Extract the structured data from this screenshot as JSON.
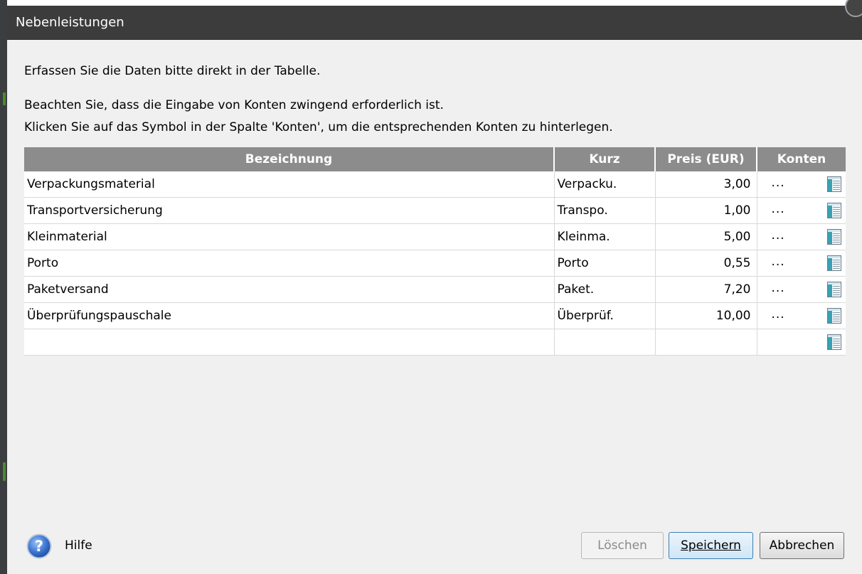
{
  "window": {
    "title": "Nebenleistungen"
  },
  "instructions": {
    "line1": "Erfassen Sie die Daten bitte direkt in der Tabelle.",
    "line2": "Beachten Sie, dass die Eingabe von Konten zwingend erforderlich ist.",
    "line3": "Klicken Sie auf das Symbol in der Spalte 'Konten', um die entsprechenden Konten zu  hinterlegen."
  },
  "table": {
    "columns": [
      "Bezeichnung",
      "Kurz",
      "Preis (EUR)",
      "Konten"
    ],
    "rows": [
      {
        "bezeichnung": "Verpackungsmaterial",
        "kurz": "Verpacku.",
        "preis": "3,00",
        "konten": "..."
      },
      {
        "bezeichnung": "Transportversicherung",
        "kurz": "Transpo.",
        "preis": "1,00",
        "konten": "..."
      },
      {
        "bezeichnung": "Kleinmaterial",
        "kurz": "Kleinma.",
        "preis": "5,00",
        "konten": "..."
      },
      {
        "bezeichnung": "Porto",
        "kurz": "Porto",
        "preis": "0,55",
        "konten": "..."
      },
      {
        "bezeichnung": "Paketversand",
        "kurz": "Paket.",
        "preis": "7,20",
        "konten": "..."
      },
      {
        "bezeichnung": "Überprüfungspauschale",
        "kurz": "Überprüf.",
        "preis": "10,00",
        "konten": "..."
      },
      {
        "bezeichnung": "",
        "kurz": "",
        "preis": "",
        "konten": ""
      }
    ],
    "konten_icon": "table-list-icon"
  },
  "footer": {
    "help_label": "Hilfe",
    "help_icon": "question-circle-icon",
    "delete_label": "Löschen",
    "save_label": "Speichern",
    "cancel_label": "Abbrechen"
  },
  "colors": {
    "titlebar": "#3c3c3c",
    "header": "#8c8c8c",
    "dialog_bg": "#f0f0f0",
    "help_icon_blue": "#2f62b8"
  }
}
